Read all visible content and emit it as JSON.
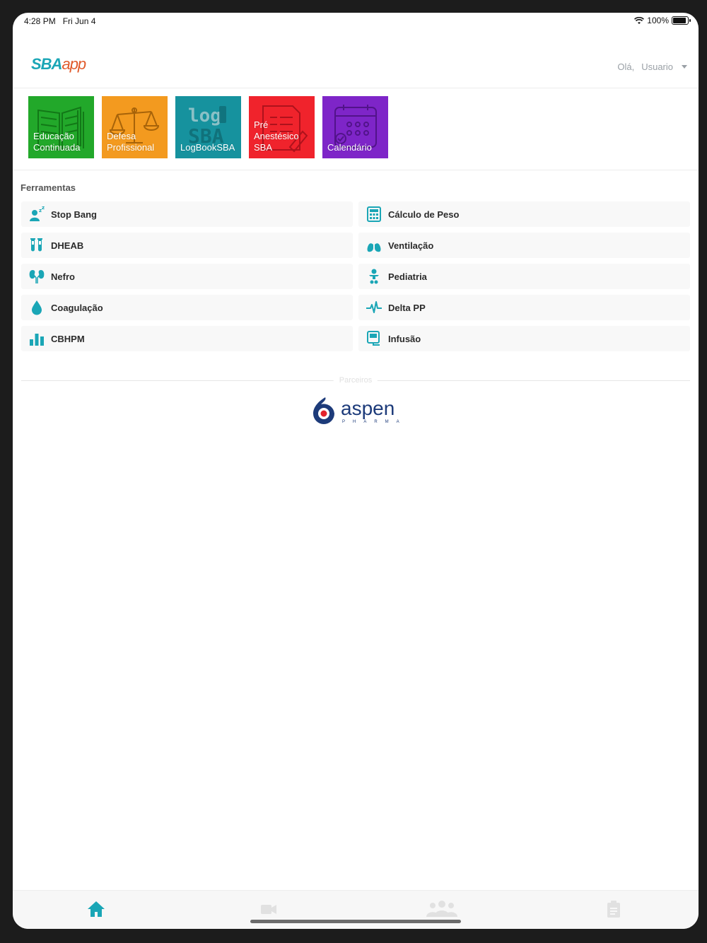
{
  "status_bar": {
    "time": "4:28 PM",
    "date": "Fri Jun 4",
    "battery": "100%",
    "battery_level": 1.0
  },
  "header": {
    "logo_sba": "SBA",
    "logo_app": "app",
    "greeting": "Olá,",
    "user": "Usuario"
  },
  "tiles": [
    {
      "label": "Educação\nContinuada",
      "color": "#22a82a",
      "icon": "book-icon"
    },
    {
      "label": "Defesa\nProfissional",
      "color": "#f39a1f",
      "icon": "scale-icon"
    },
    {
      "label": "LogBookSBA",
      "color": "#16929e",
      "icon": "logbook-icon"
    },
    {
      "label": "Pré\nAnestésico\nSBA",
      "color": "#f0232c",
      "icon": "clipboard-icon"
    },
    {
      "label": "Calendário",
      "color": "#7e25c8",
      "icon": "calendar-icon"
    }
  ],
  "tools_title": "Ferramentas",
  "tools": {
    "stop_bang": "Stop Bang",
    "calculo_peso": "Cálculo de Peso",
    "dheab": "DHEAB",
    "ventilacao": "Ventilação",
    "nefro": "Nefro",
    "pediatria": "Pediatria",
    "coagulacao": "Coagulação",
    "delta_pp": "Delta PP",
    "cbhpm": "CBHPM",
    "infusao": "Infusão"
  },
  "partners": {
    "label": "Parceiros",
    "logo_word": "aspen",
    "logo_sub": "PHARMA"
  },
  "colors": {
    "accent": "#1aa6b6",
    "logo_red": "#e05a2b",
    "aspen_blue": "#1d3b7a"
  },
  "tabbar": {
    "active": "home",
    "items": [
      "home-icon",
      "video-icon",
      "group-icon",
      "clipboard-icon"
    ]
  }
}
